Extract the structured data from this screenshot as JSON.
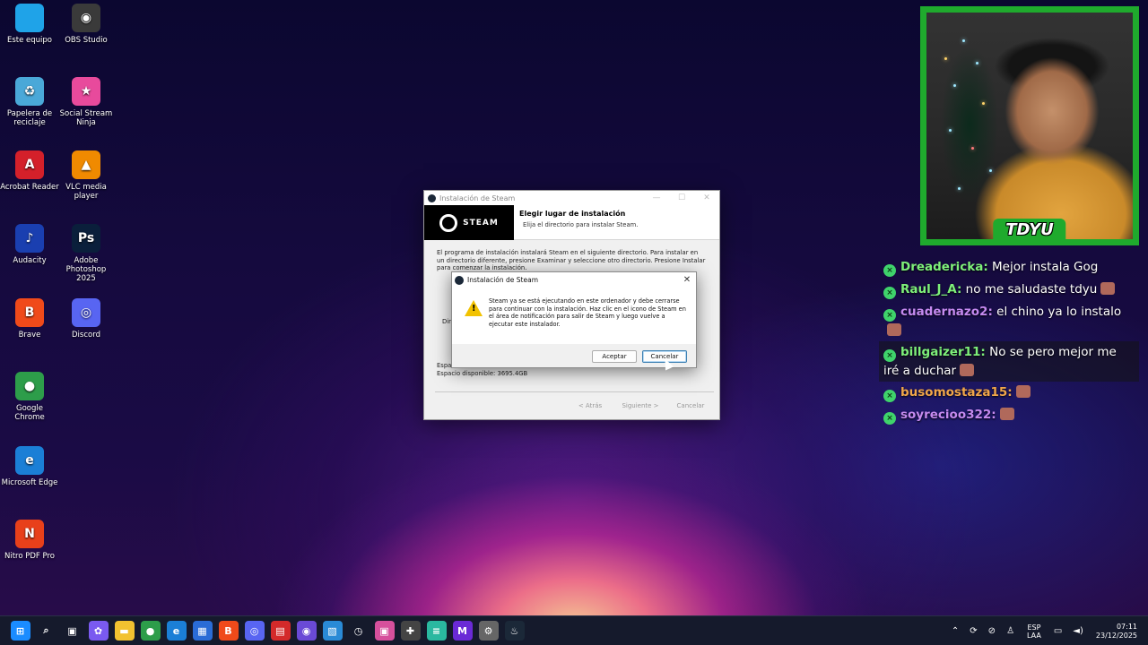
{
  "desktop": {
    "icons": [
      {
        "label": "Este equipo",
        "color": "#1fa3e8",
        "glyph": ""
      },
      {
        "label": "OBS Studio",
        "color": "#3a3a3a",
        "glyph": "◉"
      },
      {
        "label": "Papelera de reciclaje",
        "color": "#4aa8d8",
        "glyph": "♻"
      },
      {
        "label": "Social Stream Ninja",
        "color": "#e84a9c",
        "glyph": "★"
      },
      {
        "label": "Acrobat Reader",
        "color": "#d4202a",
        "glyph": "A"
      },
      {
        "label": "VLC media player",
        "color": "#f08a00",
        "glyph": "▲"
      },
      {
        "label": "Audacity",
        "color": "#1a3fb0",
        "glyph": "♪"
      },
      {
        "label": "Adobe Photoshop 2025",
        "color": "#0a1f3b",
        "glyph": "Ps"
      },
      {
        "label": "Brave",
        "color": "#f04a1a",
        "glyph": "B"
      },
      {
        "label": "Discord",
        "color": "#5865f2",
        "glyph": "◎"
      },
      {
        "label": "Google Chrome",
        "color": "#2d9d4a",
        "glyph": "●"
      },
      {
        "label": "Microsoft Edge",
        "color": "#1b7fd6",
        "glyph": "e"
      },
      {
        "label": "Nitro PDF Pro",
        "color": "#e8401a",
        "glyph": "N"
      }
    ]
  },
  "installer": {
    "title": "Instalación de Steam",
    "logo_text": "STEAM",
    "header_title": "Elegir lugar de instalación",
    "header_sub": "Elija el directorio para instalar Steam.",
    "description": "El programa de instalación instalará Steam en el siguiente directorio. Para instalar en un directorio diferente, presione Examinar y seleccione otro directorio. Presione Instalar para comenzar la instalación.",
    "dir_label": "Dir",
    "space_label": "Espa",
    "space_available": "Espacio disponible: 3695.4GB",
    "back_label": "< Atrás",
    "next_label": "Siguiente >",
    "cancel_label": "Cancelar"
  },
  "dialog": {
    "title": "Instalación de Steam",
    "close": "✕",
    "message": "Steam ya se está ejecutando en este ordenador y debe cerrarse para continuar con la instalación. Haz clic en el icono de Steam en el área de notificación para salir de Steam y luego vuelve a ejecutar este instalador.",
    "ok_label": "Aceptar",
    "cancel_label": "Cancelar"
  },
  "webcam": {
    "name": "TDYU",
    "border_color": "#1faa2d"
  },
  "chat": {
    "messages": [
      {
        "user": "Dreadericka:",
        "text": " Mejor instala Gog",
        "color": "#7ef07a",
        "highlight": false,
        "emote": false
      },
      {
        "user": "Raul_J_A:",
        "text": " no me saludaste tdyu",
        "color": "#7ef07a",
        "highlight": false,
        "emote": true
      },
      {
        "user": "cuadernazo2:",
        "text": " el chino ya lo instalo",
        "color": "#c58af0",
        "highlight": false,
        "emote": true
      },
      {
        "user": "billgaizer11:",
        "text": " No se pero mejor me iré a duchar",
        "color": "#7ef07a",
        "highlight": true,
        "emote": true
      },
      {
        "user": "busomostaza15:",
        "text": "",
        "color": "#f0a64a",
        "highlight": false,
        "emote": true
      },
      {
        "user": "soyrecioo322:",
        "text": "",
        "color": "#c58af0",
        "highlight": false,
        "emote": true
      }
    ]
  },
  "taskbar": {
    "icons": [
      {
        "name": "start-icon",
        "color": "#1a8cff",
        "glyph": "⊞"
      },
      {
        "name": "search-icon",
        "color": "transparent",
        "glyph": "⌕"
      },
      {
        "name": "task-view-icon",
        "color": "transparent",
        "glyph": "▣"
      },
      {
        "name": "copilot-icon",
        "color": "#7a5af0",
        "glyph": "✿"
      },
      {
        "name": "file-explorer-icon",
        "color": "#f2c230",
        "glyph": "▬"
      },
      {
        "name": "chrome-icon",
        "color": "#2d9d4a",
        "glyph": "●"
      },
      {
        "name": "edge-icon",
        "color": "#1b7fd6",
        "glyph": "e"
      },
      {
        "name": "store-icon",
        "color": "#2a6cd6",
        "glyph": "▦"
      },
      {
        "name": "brave-icon",
        "color": "#f04a1a",
        "glyph": "B"
      },
      {
        "name": "discord-icon",
        "color": "#5865f2",
        "glyph": "◎"
      },
      {
        "name": "news-icon",
        "color": "#d42a2a",
        "glyph": "▤"
      },
      {
        "name": "obs-icon",
        "color": "#6a4ad6",
        "glyph": "◉"
      },
      {
        "name": "photos-icon",
        "color": "#2a8ad6",
        "glyph": "▧"
      },
      {
        "name": "clock-icon",
        "color": "transparent",
        "glyph": "◷"
      },
      {
        "name": "stream-app-icon",
        "color": "#d6509c",
        "glyph": "▣"
      },
      {
        "name": "game-icon",
        "color": "#444",
        "glyph": "✚"
      },
      {
        "name": "notepad-icon",
        "color": "#2ab8a0",
        "glyph": "≡"
      },
      {
        "name": "editor-icon",
        "color": "#6a2ad6",
        "glyph": "M"
      },
      {
        "name": "settings-icon",
        "color": "#666",
        "glyph": "⚙"
      },
      {
        "name": "steam-icon",
        "color": "#1b2838",
        "glyph": "♨"
      }
    ],
    "lang_top": "ESP",
    "lang_bottom": "LAA",
    "time": "07:11",
    "date": "23/12/2025"
  }
}
